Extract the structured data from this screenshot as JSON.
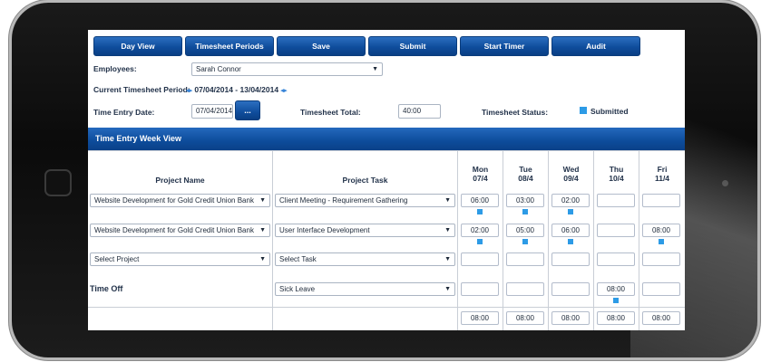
{
  "toolbar": {
    "buttons": [
      "Day View",
      "Timesheet Periods",
      "Save",
      "Submit",
      "Start Timer",
      "Audit"
    ]
  },
  "form": {
    "employees_label": "Employees:",
    "employee_value": "Sarah Connor",
    "period_label": "Current Timesheet Period:",
    "period_value": "07/04/2014 - 13/04/2014",
    "entry_date_label": "Time Entry Date:",
    "entry_date_value": "07/04/2014",
    "calendar_button": "...",
    "total_label": "Timesheet Total:",
    "total_value": "40:00",
    "status_label": "Timesheet Status:",
    "status_value": "Submitted"
  },
  "week_view": {
    "title": "Time Entry Week View",
    "col_project": "Project Name",
    "col_task": "Project Task",
    "days": [
      {
        "name": "Mon",
        "date": "07/4"
      },
      {
        "name": "Tue",
        "date": "08/4"
      },
      {
        "name": "Wed",
        "date": "09/4"
      },
      {
        "name": "Thu",
        "date": "10/4"
      },
      {
        "name": "Fri",
        "date": "11/4"
      }
    ],
    "rows": [
      {
        "project": "Website Development for Gold Credit Union Bank",
        "task": "Client Meeting - Requirement Gathering",
        "hours": [
          "06:00",
          "03:00",
          "02:00",
          "",
          ""
        ]
      },
      {
        "project": "Website Development for Gold Credit Union Bank",
        "task": "User Interface Development",
        "hours": [
          "02:00",
          "05:00",
          "06:00",
          "",
          "08:00"
        ]
      },
      {
        "project": "Select Project",
        "task": "Select Task",
        "hours": [
          "",
          "",
          "",
          "",
          ""
        ]
      }
    ],
    "time_off": {
      "label": "Time Off",
      "task": "Sick Leave",
      "hours": [
        "",
        "",
        "",
        "08:00",
        ""
      ]
    },
    "totals": [
      "08:00",
      "08:00",
      "08:00",
      "08:00",
      "08:00"
    ]
  },
  "colors": {
    "accent": "#0f4d9c",
    "status": "#2d9be6"
  }
}
